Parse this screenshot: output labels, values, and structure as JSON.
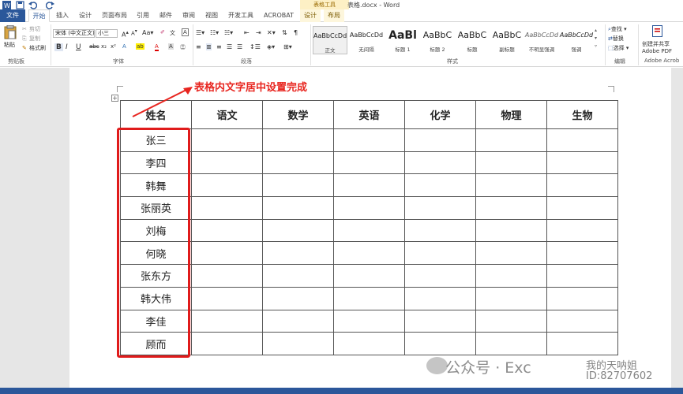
{
  "window": {
    "title": "表格.docx - Word",
    "context_tab_group": "表格工具"
  },
  "tabs": [
    {
      "label": "文件"
    },
    {
      "label": "开始"
    },
    {
      "label": "插入"
    },
    {
      "label": "设计"
    },
    {
      "label": "页面布局"
    },
    {
      "label": "引用"
    },
    {
      "label": "邮件"
    },
    {
      "label": "审阅"
    },
    {
      "label": "视图"
    },
    {
      "label": "开发工具"
    },
    {
      "label": "ACROBAT"
    },
    {
      "label": "设计"
    },
    {
      "label": "布局"
    }
  ],
  "ribbon": {
    "clipboard": {
      "paste": "粘贴",
      "cut": "剪切",
      "copy": "复制",
      "format_painter": "格式刷",
      "label": "剪贴板"
    },
    "font": {
      "name": "宋体 (中文正文)",
      "size": "小三",
      "label": "字体",
      "bold": "B",
      "italic": "I",
      "underline": "U"
    },
    "paragraph": {
      "label": "段落"
    },
    "styles": {
      "label": "样式",
      "items": [
        {
          "sample": "AaBbCcDd",
          "name": "正文"
        },
        {
          "sample": "AaBbCcDd",
          "name": "无间隔"
        },
        {
          "sample": "AaBl",
          "name": "标题 1"
        },
        {
          "sample": "AaBbC",
          "name": "标题 2"
        },
        {
          "sample": "AaBbC",
          "name": "标题"
        },
        {
          "sample": "AaBbC",
          "name": "副标题"
        },
        {
          "sample": "AaBbCcDd",
          "name": "不明显强调"
        },
        {
          "sample": "AaBbCcDd",
          "name": "强调"
        }
      ]
    },
    "editing": {
      "find": "查找",
      "replace": "替换",
      "select": "选择",
      "label": "编辑"
    },
    "acrobat": {
      "create_share": "创建并共享",
      "adobe_pdf": "Adobe PDF",
      "label": "Adobe Acrob"
    }
  },
  "document": {
    "annotation": "表格内文字居中设置完成",
    "table": {
      "headers": [
        "姓名",
        "语文",
        "数学",
        "英语",
        "化学",
        "物理",
        "生物"
      ],
      "names": [
        "张三",
        "李四",
        "韩舞",
        "张丽英",
        "刘梅",
        "何晓",
        "张东方",
        "韩大伟",
        "李佳",
        "顾而"
      ]
    }
  },
  "watermark": {
    "text": "公众号 · Exc",
    "author": "我的天呐姐",
    "id": "ID:82707602"
  },
  "colors": {
    "brand": "#2b579a",
    "annotation_red": "#e8251f",
    "highlight_red": "#e01b1b"
  }
}
